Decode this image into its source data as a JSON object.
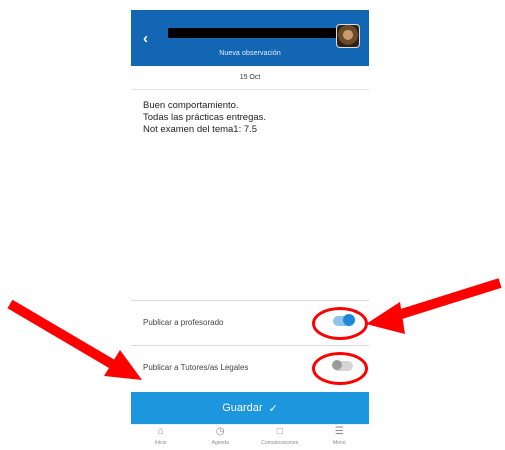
{
  "header": {
    "back_icon": "chevron-left-icon",
    "subtitle": "Nueva observación",
    "avatar_icon": "user-avatar"
  },
  "date": "15 Oct",
  "observation": {
    "lines": [
      "Buen comportamiento.",
      "Todas las prácticas entregas.",
      "Not examen del tema1:  7.5"
    ]
  },
  "toggles": [
    {
      "label": "Publicar a profesorado",
      "state": "on"
    },
    {
      "label": "Publicar a Tutores/as Legales",
      "state": "off"
    }
  ],
  "save": {
    "label": "Guardar",
    "icon": "check-icon"
  },
  "bottom_nav": [
    {
      "label": "Inicio",
      "icon": "home-icon"
    },
    {
      "label": "Agenda",
      "icon": "clock-icon"
    },
    {
      "label": "Comunicaciones",
      "icon": "chat-icon"
    },
    {
      "label": "Menú",
      "icon": "menu-icon"
    }
  ],
  "colors": {
    "header_blue": "#1366b3",
    "save_blue": "#1c96dd",
    "toggle_on": "#1e88d9",
    "annotation_red": "#ff0000"
  }
}
